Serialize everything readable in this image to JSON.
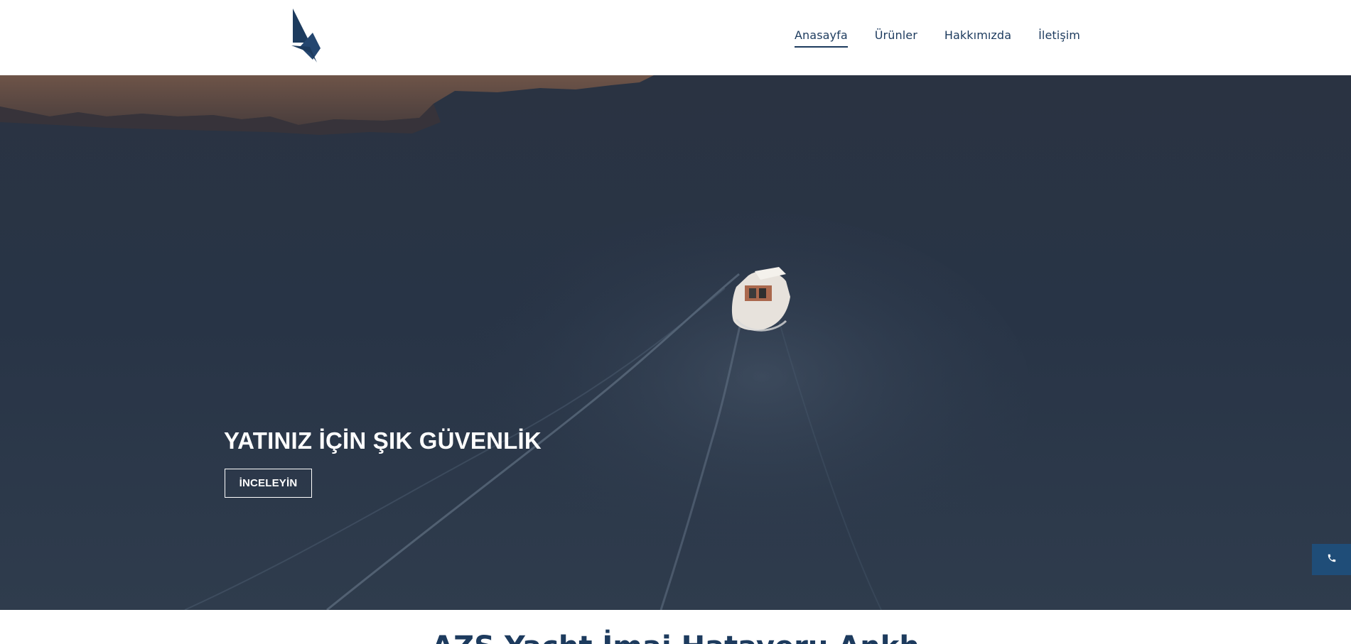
{
  "header": {
    "logo_icon": "sailboat-logo-icon",
    "nav": [
      {
        "label": "Anasayfa",
        "active": true
      },
      {
        "label": "Ürünler",
        "active": false
      },
      {
        "label": "Hakkımızda",
        "active": false
      },
      {
        "label": "İletişim",
        "active": false
      }
    ]
  },
  "hero": {
    "title": "YATINIZ İÇİN ŞIK GÜVENLİK",
    "button_label": "İNCELEYİN",
    "background_image": "aerial-boat-on-sea"
  },
  "floating": {
    "phone_icon": "phone-icon"
  },
  "section": {
    "title": "AZS Yacht İmaj Hatayeru Ankh"
  },
  "colors": {
    "primary": "#1d3b5e",
    "accent": "#1f4d78",
    "sea": "#2d3a4c",
    "white": "#ffffff"
  }
}
